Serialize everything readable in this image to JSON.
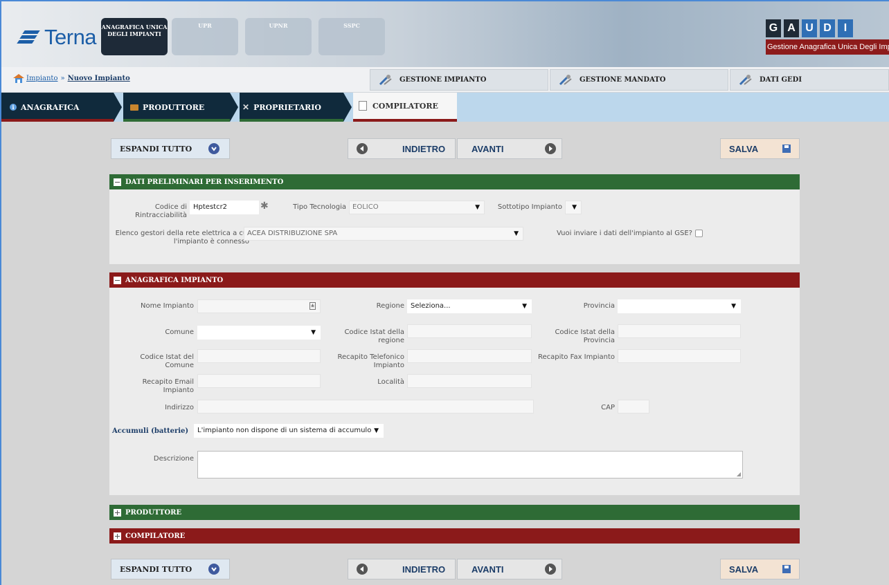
{
  "header": {
    "logo_text": "Terna",
    "tabs": [
      {
        "label": "ANAGRAFICA UNICA DEGLI IMPIANTI",
        "active": true
      },
      {
        "label": "UPR",
        "active": false
      },
      {
        "label": "UPNR",
        "active": false
      },
      {
        "label": "SSPC",
        "active": false
      }
    ],
    "gaudi_letters": [
      "G",
      "A",
      "U",
      "D",
      "I"
    ],
    "gaudi_subtitle": "Gestione Anagrafica Unica Degli Impianti"
  },
  "breadcrumb": {
    "link": "Impianto",
    "separator": "»",
    "current": "Nuovo Impianto"
  },
  "top_buttons": [
    "GESTIONE IMPIANTO",
    "GESTIONE MANDATO",
    "DATI GEDI"
  ],
  "steps": [
    "ANAGRAFICA",
    "PRODUTTORE",
    "PROPRIETARIO",
    "COMPILATORE"
  ],
  "toolbar": {
    "expand_label": "ESPANDI TUTTO",
    "back_label": "INDIETRO",
    "next_label": "AVANTI",
    "save_label": "SALVA"
  },
  "sections": {
    "preliminari": {
      "title": "DATI PRELIMINARI PER INSERIMENTO",
      "codice_label": "Codice di Rintracciabilità",
      "codice_value": "Hptestcr2",
      "tecnologia_label": "Tipo Tecnologia",
      "tecnologia_value": "EOLICO",
      "sottotipo_label": "Sottotipo Impianto",
      "gestori_label": "Elenco gestori della rete elettrica a cui l'impianto è connesso",
      "gestori_value": "ACEA DISTRIBUZIONE SPA",
      "gse_label": "Vuoi inviare i dati dell'impianto al GSE?"
    },
    "anagrafica": {
      "title": "ANAGRAFICA IMPIANTO",
      "nome_label": "Nome Impianto",
      "regione_label": "Regione",
      "regione_value": "Seleziona...",
      "provincia_label": "Provincia",
      "comune_label": "Comune",
      "istat_regione_label": "Codice Istat della regione",
      "istat_provincia_label": "Codice Istat della Provincia",
      "istat_comune_label": "Codice Istat del Comune",
      "telefono_label": "Recapito Telefonico Impianto",
      "fax_label": "Recapito Fax Impianto",
      "email_label": "Recapito Email Impianto",
      "localita_label": "Località",
      "indirizzo_label": "Indirizzo",
      "cap_label": "CAP",
      "accumuli_label": "Accumuli (batterie)",
      "accumuli_value": "L'impianto non dispone di un sistema di accumulo",
      "descrizione_label": "Descrizione"
    },
    "produttore": {
      "title": "PRODUTTORE"
    },
    "compilatore": {
      "title": "COMPILATORE"
    }
  },
  "colors": {
    "green": "#2e6b35",
    "red": "#8b1a1a",
    "navy": "#102a3c",
    "brand_blue": "#1c5ea7"
  }
}
